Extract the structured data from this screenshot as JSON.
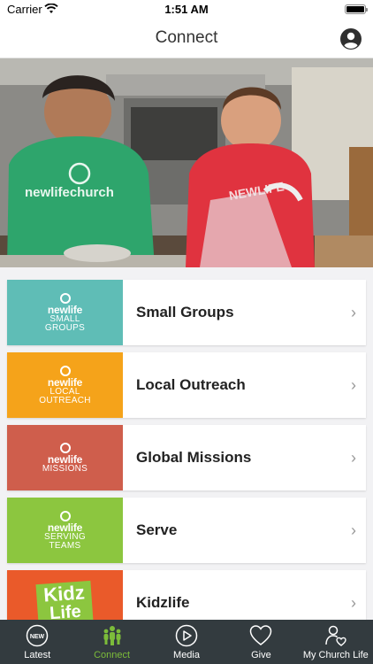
{
  "status_bar": {
    "carrier": "Carrier",
    "time": "1:51 AM"
  },
  "header": {
    "title": "Connect",
    "profile_icon": "user-circle-icon"
  },
  "hero": {
    "shirt_text_left": "newlifechurch",
    "shirt_text_right": "NEWLIFE"
  },
  "items": [
    {
      "label": "Small Groups",
      "brand": "newlife",
      "sub1": "SMALL",
      "sub2": "GROUPS",
      "color": "#5fbdb6"
    },
    {
      "label": "Local Outreach",
      "brand": "newlife",
      "sub1": "LOCAL",
      "sub2": "OUTREACH",
      "color": "#f5a31a"
    },
    {
      "label": "Global Missions",
      "brand": "newlife",
      "sub1": "MISSIONS",
      "sub2": "",
      "color": "#cf5e4c"
    },
    {
      "label": "Serve",
      "brand": "newlife",
      "sub1": "SERVING",
      "sub2": "TEAMS",
      "color": "#8cc63f"
    },
    {
      "label": "Kidzlife",
      "brand": "Kidz",
      "sub1": "Life",
      "sub2": "",
      "color": "#ea5a2a"
    }
  ],
  "tabs": [
    {
      "label": "Latest",
      "icon": "new-badge-icon"
    },
    {
      "label": "Connect",
      "icon": "people-icon"
    },
    {
      "label": "Media",
      "icon": "play-circle-icon"
    },
    {
      "label": "Give",
      "icon": "heart-icon"
    },
    {
      "label": "My Church Life",
      "icon": "person-heart-icon"
    }
  ],
  "active_tab": "Connect",
  "colors": {
    "accent": "#7cbc3a",
    "tab_bar": "#333b3f"
  }
}
